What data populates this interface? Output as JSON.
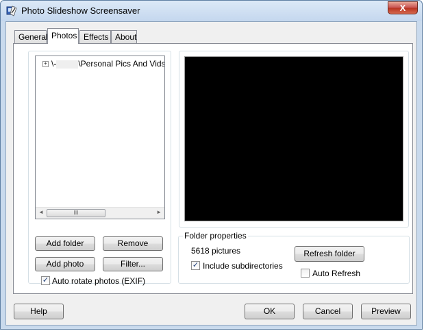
{
  "window": {
    "title": "Photo Slideshow Screensaver",
    "close_glyph": "X"
  },
  "tabs": [
    {
      "label": "General"
    },
    {
      "label": "Photos"
    },
    {
      "label": "Effects"
    },
    {
      "label": "About"
    }
  ],
  "active_tab": "Photos",
  "folders": {
    "tree_item": {
      "expander": "+",
      "prefix": "\\-",
      "path": "\\Personal Pics And Vids\\("
    },
    "scrollbar": {
      "left_arrow": "◄",
      "right_arrow": "►",
      "thumb_grip": "III"
    },
    "buttons": {
      "add_folder": "Add folder",
      "remove": "Remove",
      "add_photo": "Add photo",
      "filter": "Filter..."
    },
    "auto_rotate": {
      "label": "Auto rotate photos (EXIF)",
      "checked": true
    }
  },
  "folder_properties": {
    "title": "Folder properties",
    "picture_count": "5618 pictures",
    "refresh_button": "Refresh folder",
    "include_subdirectories": {
      "label": "Include subdirectories",
      "checked": true
    },
    "auto_refresh": {
      "label": "Auto Refresh",
      "checked": false
    }
  },
  "footer": {
    "help": "Help",
    "ok": "OK",
    "cancel": "Cancel",
    "preview": "Preview"
  },
  "colors": {
    "window_frame": "#c9daed",
    "close_button": "#c75050",
    "preview_background": "#000000",
    "checkmark": "#1f3f7a"
  },
  "icons": {
    "app": "slideshow-app-icon",
    "checkmark": "✓"
  }
}
